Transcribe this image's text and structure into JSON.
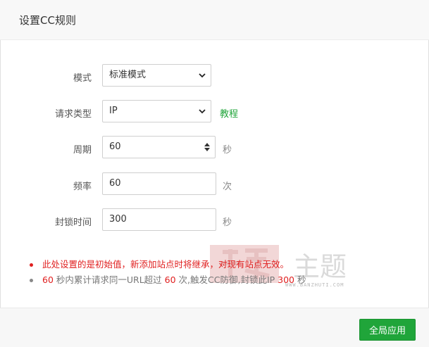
{
  "dialog": {
    "title": "设置CC规则"
  },
  "form": {
    "mode": {
      "label": "模式",
      "value": "标准模式"
    },
    "request_type": {
      "label": "请求类型",
      "value": "IP",
      "link": "教程"
    },
    "period": {
      "label": "周期",
      "value": "60",
      "unit": "秒"
    },
    "frequency": {
      "label": "频率",
      "value": "60",
      "unit": "次"
    },
    "ban_time": {
      "label": "封锁时间",
      "value": "300",
      "unit": "秒"
    }
  },
  "notes": {
    "warning": "此处设置的是初始值，新添加站点时将继承，对现有站点无效。",
    "summary": {
      "period": "60",
      "text1": " 秒内累计请求同一URL超过 ",
      "count": "60",
      "text2": " 次,触发CC防御,封锁此IP ",
      "ban": "300",
      "text3": " 秒"
    }
  },
  "footer": {
    "apply_label": "全局应用"
  },
  "watermark": {
    "glyphs": "主题",
    "text": "WWW.BANZHUTI.COM"
  },
  "colors": {
    "accent": "#20a53a",
    "warning": "#e02020"
  }
}
